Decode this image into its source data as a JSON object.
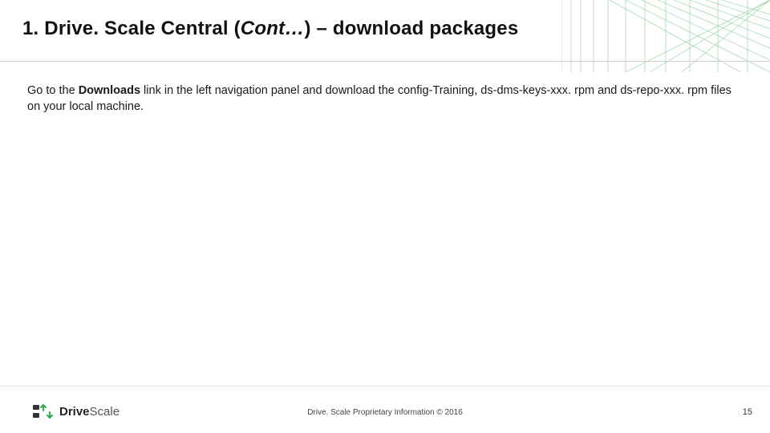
{
  "title": {
    "prefix": "1. Drive. Scale Central (",
    "cont": "Cont…",
    "suffix": ") – download packages"
  },
  "body": {
    "t1": "Go to the ",
    "bold": "Downloads",
    "t2": " link in the left navigation panel and download the config-Training, ds-dms-keys-xxx. rpm and ds-repo-xxx. rpm files on your local machine."
  },
  "footer": {
    "logo_bold": "Drive",
    "logo_light": "Scale",
    "copyright": "Drive. Scale Proprietary Information © 2016",
    "page": "15"
  }
}
